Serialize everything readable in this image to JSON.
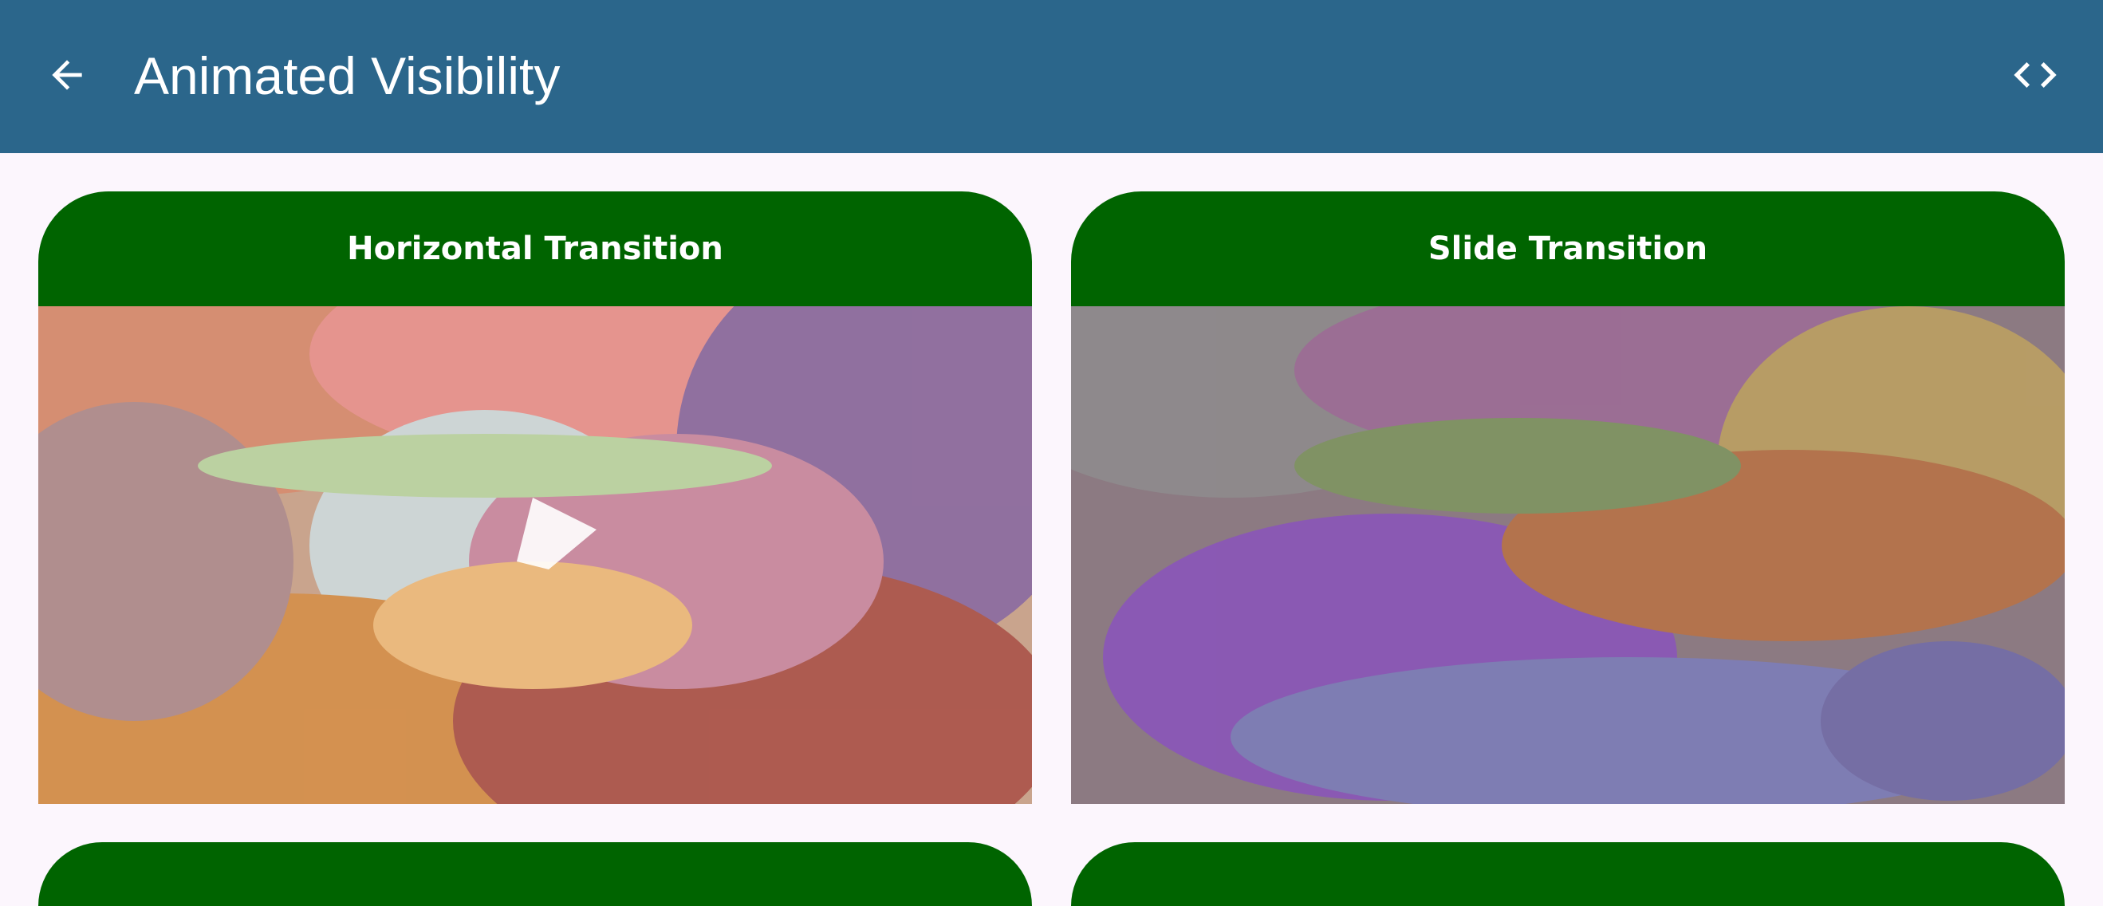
{
  "app_bar": {
    "title": "Animated Visibility",
    "back_icon": "arrow-back-icon",
    "code_icon": "code-icon",
    "background_color": "#2b668b"
  },
  "cards": [
    {
      "title": "Horizontal Transition",
      "header_color": "#006400"
    },
    {
      "title": "Slide Transition",
      "header_color": "#006400"
    }
  ],
  "page_background": "#fcf6fd"
}
